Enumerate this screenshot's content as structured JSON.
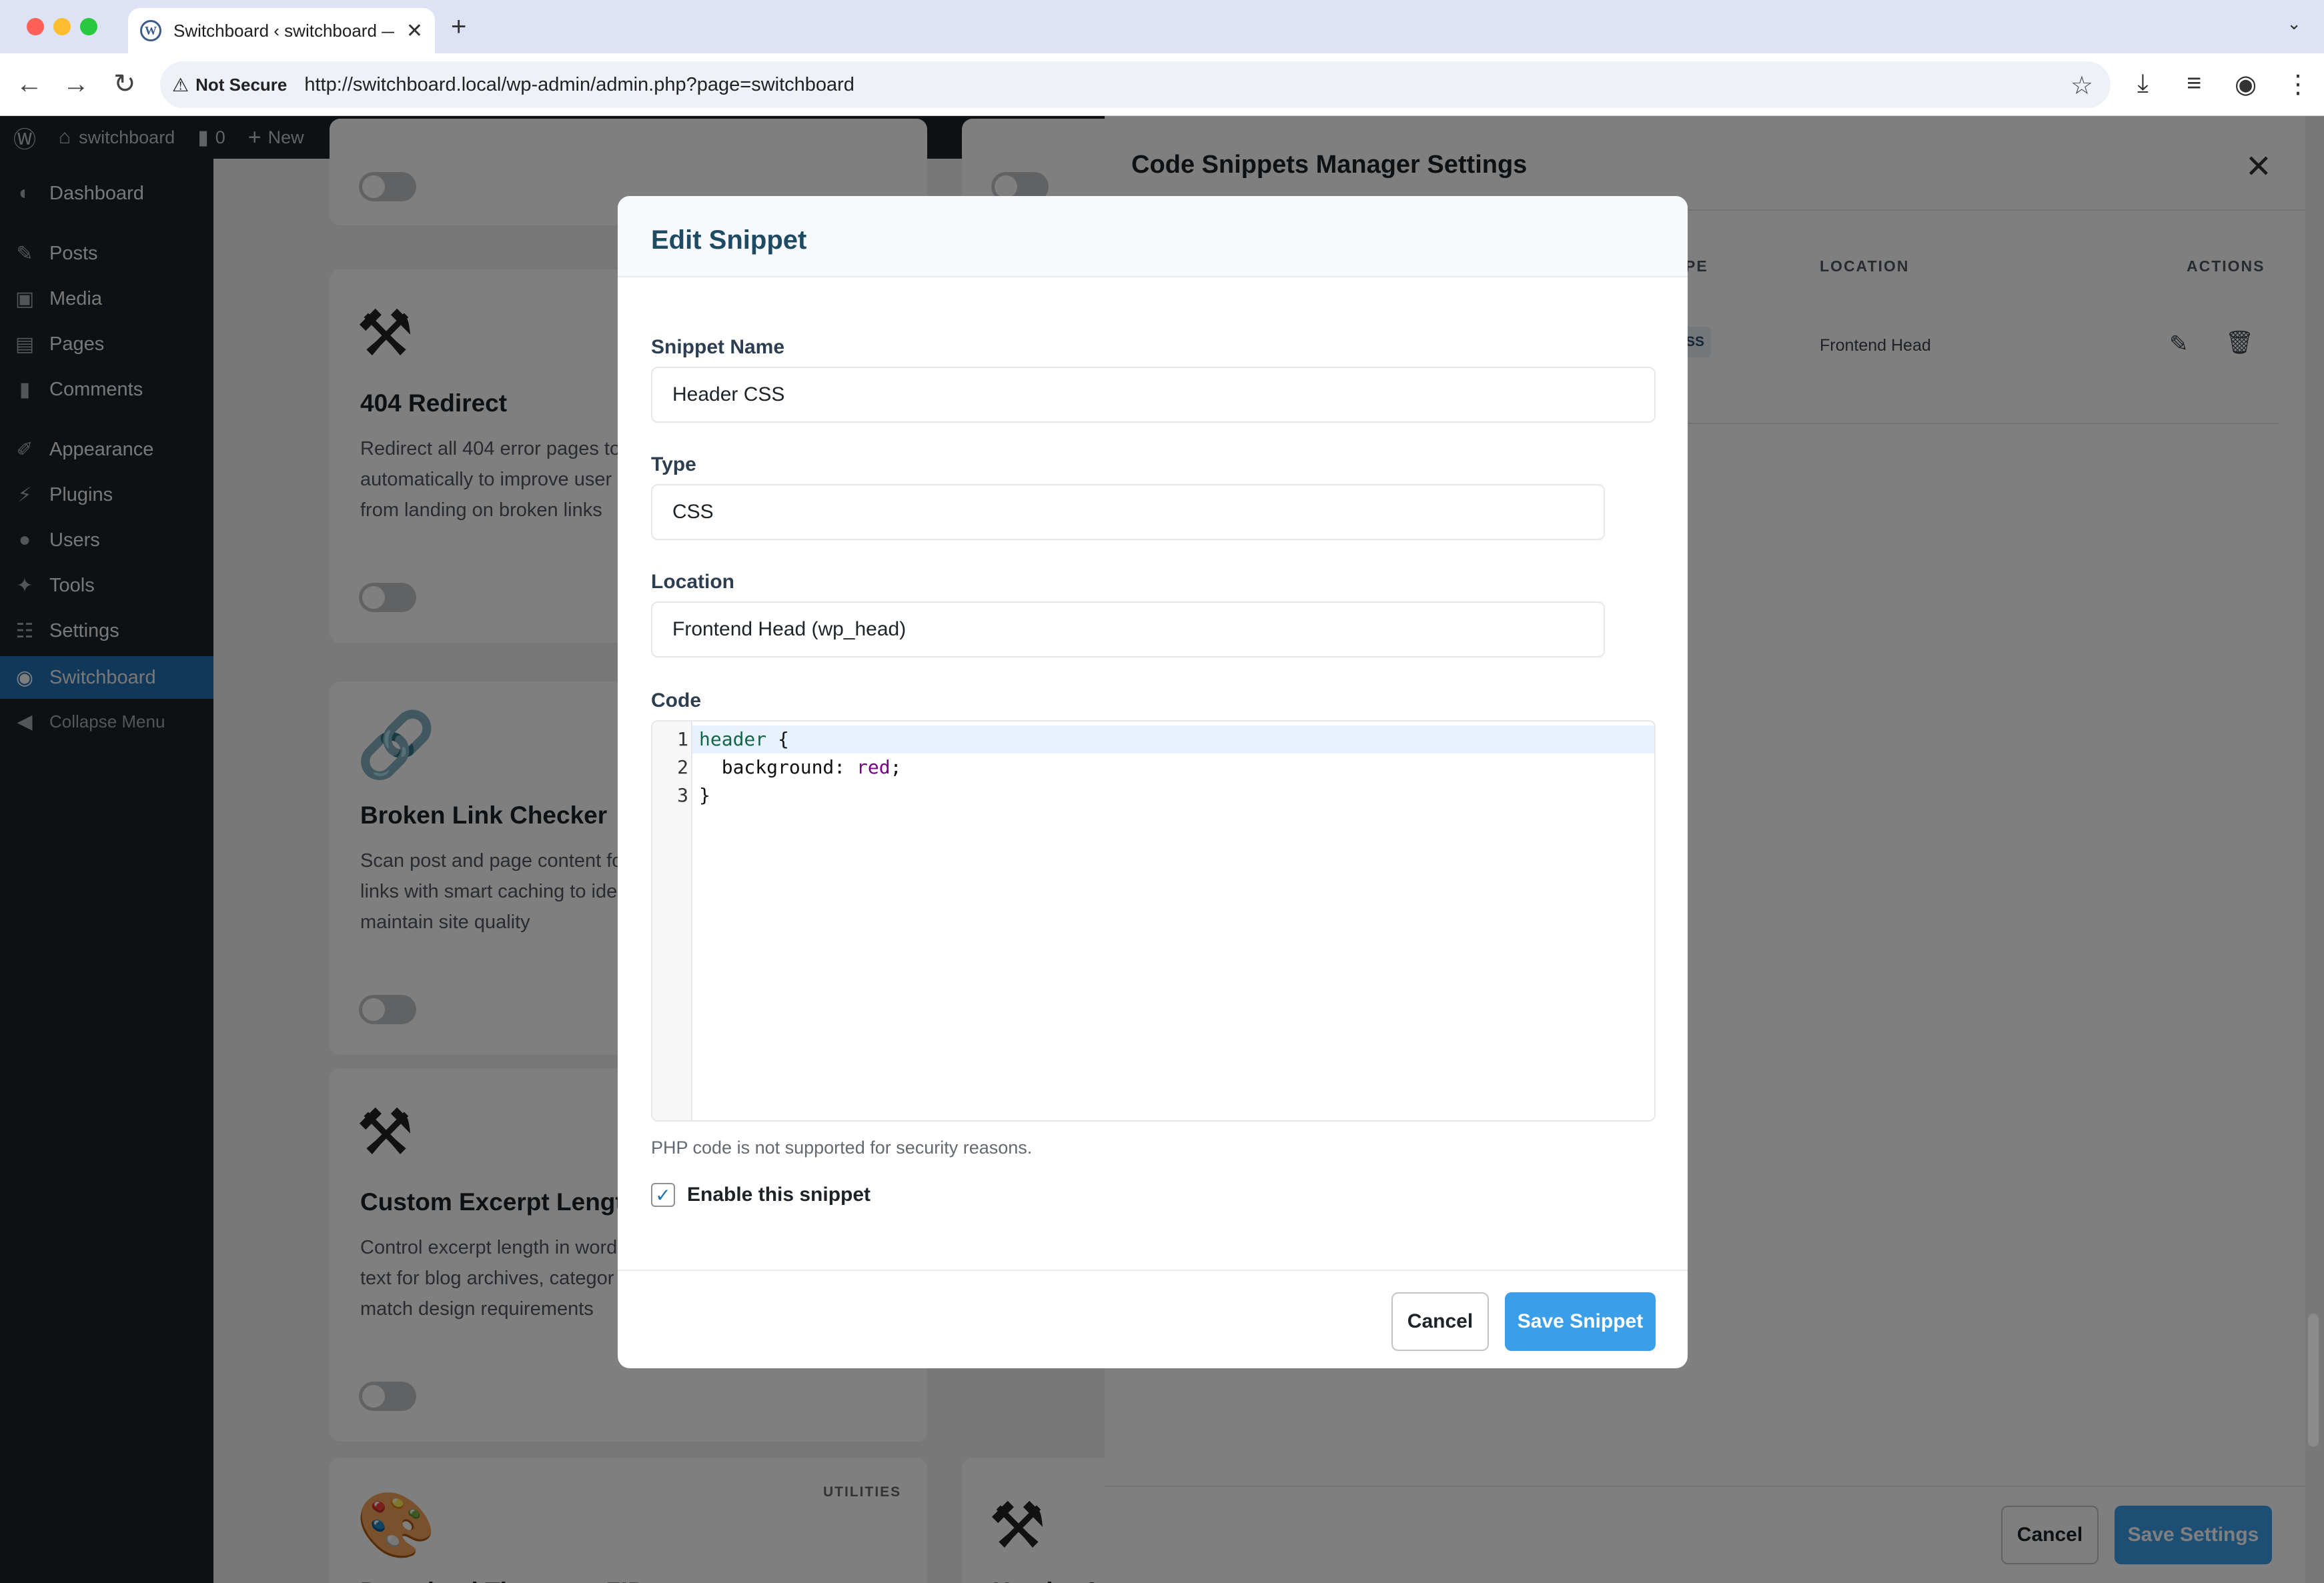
{
  "browser": {
    "tab_title": "Switchboard ‹ switchboard —",
    "tab_favicon": "wordpress-icon",
    "security_label": "Not Secure",
    "url": "http://switchboard.local/wp-admin/admin.php?page=switchboard"
  },
  "adminbar": {
    "site_name": "switchboard",
    "comments_count": "0",
    "new_label": "New"
  },
  "sidebar": {
    "items": [
      {
        "label": "Dashboard",
        "icon": "dashboard-icon"
      },
      {
        "label": "Posts",
        "icon": "pin-icon"
      },
      {
        "label": "Media",
        "icon": "media-icon"
      },
      {
        "label": "Pages",
        "icon": "page-icon"
      },
      {
        "label": "Comments",
        "icon": "comment-icon"
      },
      {
        "label": "Appearance",
        "icon": "brush-icon"
      },
      {
        "label": "Plugins",
        "icon": "plug-icon"
      },
      {
        "label": "Users",
        "icon": "user-icon"
      },
      {
        "label": "Tools",
        "icon": "wrench-icon"
      },
      {
        "label": "Settings",
        "icon": "sliders-icon"
      },
      {
        "label": "Switchboard",
        "icon": "switchboard-icon"
      },
      {
        "label": "Collapse Menu",
        "icon": "collapse-icon"
      }
    ]
  },
  "cards": [
    {
      "title": "404 Redirect",
      "desc": "Redirect all 404 error pages to automatically to improve user from landing on broken links"
    },
    {
      "title": "Broken Link Checker",
      "desc": "Scan post and page content fo links with smart caching to ide maintain site quality"
    },
    {
      "title": "Custom Excerpt Length",
      "desc": "Control excerpt length in word text for blog archives, categor match design requirements"
    },
    {
      "title": "Download Theme as ZIP",
      "badge": "UTILITIES"
    },
    {
      "title": "Header & F"
    }
  ],
  "panel": {
    "title": "Code Snippets Manager Settings",
    "columns": {
      "type": "PE",
      "location": "LOCATION",
      "actions": "ACTIONS"
    },
    "row": {
      "type": "SS",
      "location": "Frontend Head"
    },
    "cancel_label": "Cancel",
    "save_label": "Save Settings"
  },
  "modal": {
    "title": "Edit Snippet",
    "name_label": "Snippet Name",
    "name_value": "Header CSS",
    "type_label": "Type",
    "type_value": "CSS",
    "location_label": "Location",
    "location_value": "Frontend Head (wp_head)",
    "code_label": "Code",
    "code": {
      "line1_sel": "header",
      "line1_rest": " {",
      "line2_prop": "  background: ",
      "line2_val": "red",
      "line2_end": ";",
      "line3": "}"
    },
    "line_numbers": [
      "1",
      "2",
      "3"
    ],
    "note": "PHP code is not supported for security reasons.",
    "enable_label": "Enable this snippet",
    "enable_checked": true,
    "cancel_label": "Cancel",
    "save_label": "Save Snippet"
  },
  "colors": {
    "accent": "#3a9ee9",
    "admin_dark": "#1d2327",
    "title_blue": "#1e4a64"
  }
}
